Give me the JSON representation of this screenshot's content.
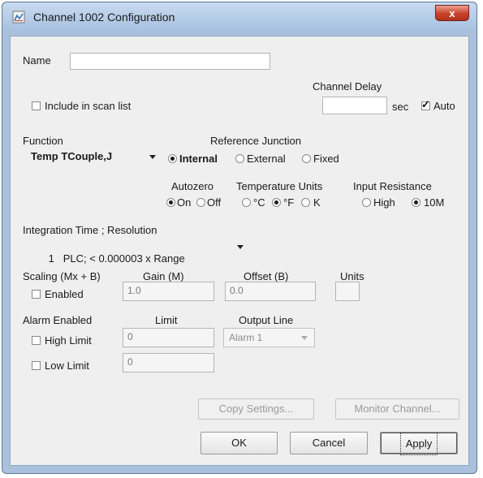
{
  "window": {
    "title": "Channel 1002 Configuration",
    "close_label": "x"
  },
  "name": {
    "label": "Name",
    "value": ""
  },
  "scan": {
    "label": "Include in scan list",
    "checked": false
  },
  "channel_delay": {
    "label": "Channel Delay",
    "value": "",
    "unit": "sec",
    "auto_label": "Auto",
    "auto_checked": true
  },
  "function": {
    "label": "Function",
    "selected": "Temp TCouple,J"
  },
  "reference_junction": {
    "label": "Reference Junction",
    "options": [
      "Internal",
      "External",
      "Fixed"
    ],
    "selected": "Internal"
  },
  "autozero": {
    "label": "Autozero",
    "options": [
      "On",
      "Off"
    ],
    "selected": "On"
  },
  "temperature_units": {
    "label": "Temperature Units",
    "options": [
      "°C",
      "°F",
      "K"
    ],
    "selected": "°F"
  },
  "input_resistance": {
    "label": "Input Resistance",
    "options": [
      "High",
      "10M"
    ],
    "selected": "10M"
  },
  "integration": {
    "label": "Integration Time ; Resolution",
    "selected": "1   PLC; < 0.000003 x Range"
  },
  "scaling": {
    "label": "Scaling (Mx + B)",
    "enabled_label": "Enabled",
    "enabled": false,
    "gain_label": "Gain (M)",
    "gain_value": "1.0",
    "offset_label": "Offset (B)",
    "offset_value": "0.0",
    "units_label": "Units",
    "units_value": ""
  },
  "alarm": {
    "label": "Alarm Enabled",
    "limit_label": "Limit",
    "output_line_label": "Output Line",
    "high_label": "High Limit",
    "high_checked": false,
    "high_value": "0",
    "output_line_value": "Alarm 1",
    "low_label": "Low Limit",
    "low_checked": false,
    "low_value": "0"
  },
  "buttons": {
    "copy": "Copy Settings...",
    "monitor": "Monitor Channel...",
    "ok": "OK",
    "cancel": "Cancel",
    "apply": "Apply"
  }
}
